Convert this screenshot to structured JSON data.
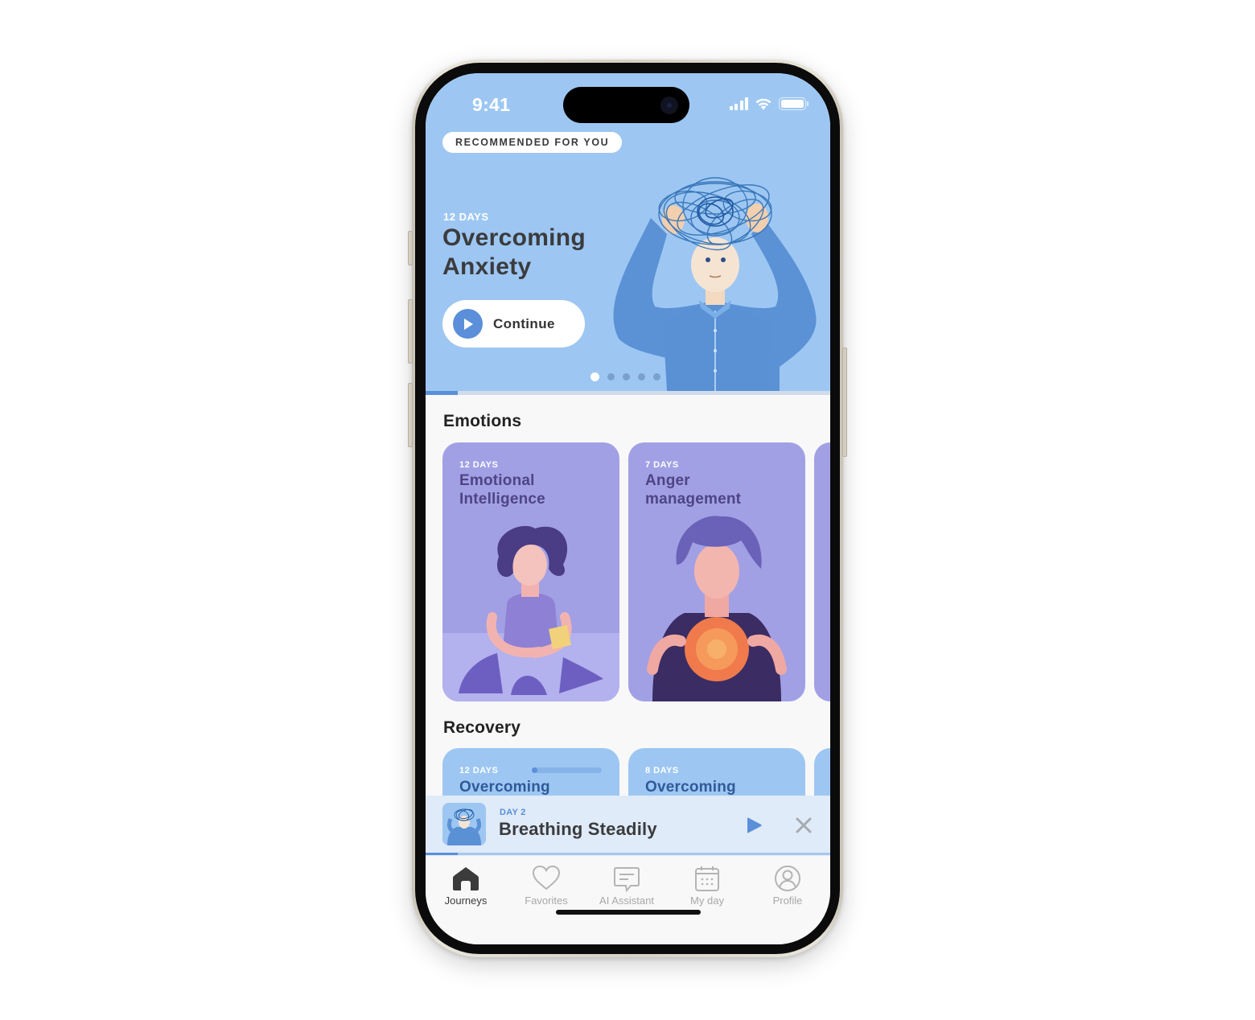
{
  "status_bar": {
    "time": "9:41"
  },
  "hero": {
    "badge": "RECOMMENDED FOR YOU",
    "duration": "12 DAYS",
    "title": "Overcoming Anxiety",
    "cta_label": "Continue",
    "carousel": {
      "total_slides": 5,
      "active_index": 0
    },
    "progress_fraction": 0.08,
    "illustration": "anxious-man-tangled-thoughts"
  },
  "sections": [
    {
      "title": "Emotions",
      "cards": [
        {
          "duration": "12 DAYS",
          "title": "Emotional Intelligence",
          "illustration": "woman-with-masks"
        },
        {
          "duration": "7 DAYS",
          "title": "Anger management",
          "illustration": "man-with-fireball"
        }
      ]
    },
    {
      "title": "Recovery",
      "cards": [
        {
          "duration": "12 DAYS",
          "title": "Overcoming",
          "progress_fraction": 0.08
        },
        {
          "duration": "8 DAYS",
          "title": "Overcoming"
        }
      ]
    }
  ],
  "mini_player": {
    "day": "DAY 2",
    "title": "Breathing Steadily",
    "progress_fraction": 0.08,
    "play_icon": "play-icon",
    "close_icon": "close-icon"
  },
  "tab_bar": {
    "active": "Journeys",
    "tabs": [
      {
        "label": "Journeys",
        "icon": "home-icon"
      },
      {
        "label": "Favorites",
        "icon": "heart-icon"
      },
      {
        "label": "AI Assistant",
        "icon": "chat-icon"
      },
      {
        "label": "My day",
        "icon": "calendar-icon"
      },
      {
        "label": "Profile",
        "icon": "profile-icon"
      }
    ]
  },
  "colors": {
    "hero_bg": "#9dc7f2",
    "accent": "#5b8fd9",
    "emotions_card": "#a2a0e4",
    "recovery_card": "#9dc7f2",
    "player_bg": "#dfebf8"
  }
}
